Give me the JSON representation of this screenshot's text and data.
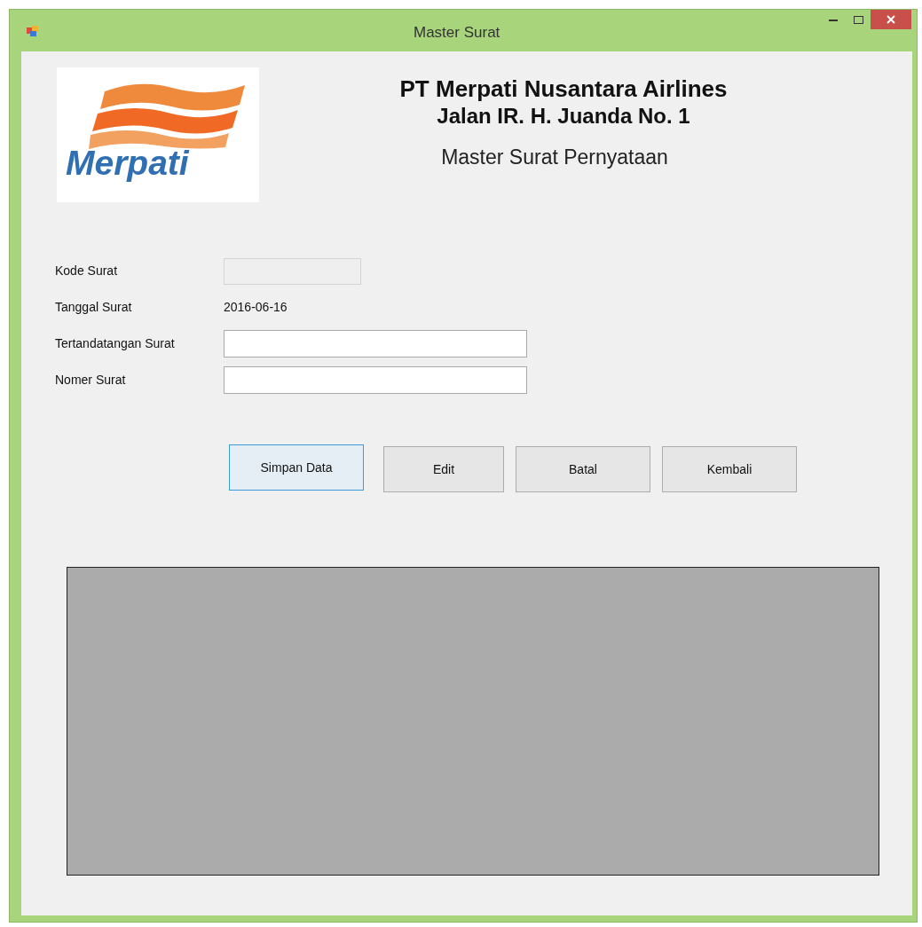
{
  "window": {
    "title": "Master Surat"
  },
  "header": {
    "logo_text": "Merpati",
    "company": "PT Merpati Nusantara Airlines",
    "address": "Jalan IR. H. Juanda No. 1",
    "form_title": "Master Surat Pernyataan"
  },
  "fields": [
    {
      "label": "Kode Surat",
      "kind": "disabled"
    },
    {
      "label": "Tanggal Surat",
      "kind": "text",
      "value": "2016-06-16"
    },
    {
      "label": "Tertandatangan Surat",
      "kind": "input"
    },
    {
      "label": "Nomer Surat",
      "kind": "input"
    }
  ],
  "buttons": [
    {
      "label": "Simpan Data",
      "focused": true
    },
    {
      "label": "Edit",
      "focused": false
    },
    {
      "label": "Batal",
      "focused": false
    },
    {
      "label": "Kembali",
      "focused": false
    }
  ]
}
